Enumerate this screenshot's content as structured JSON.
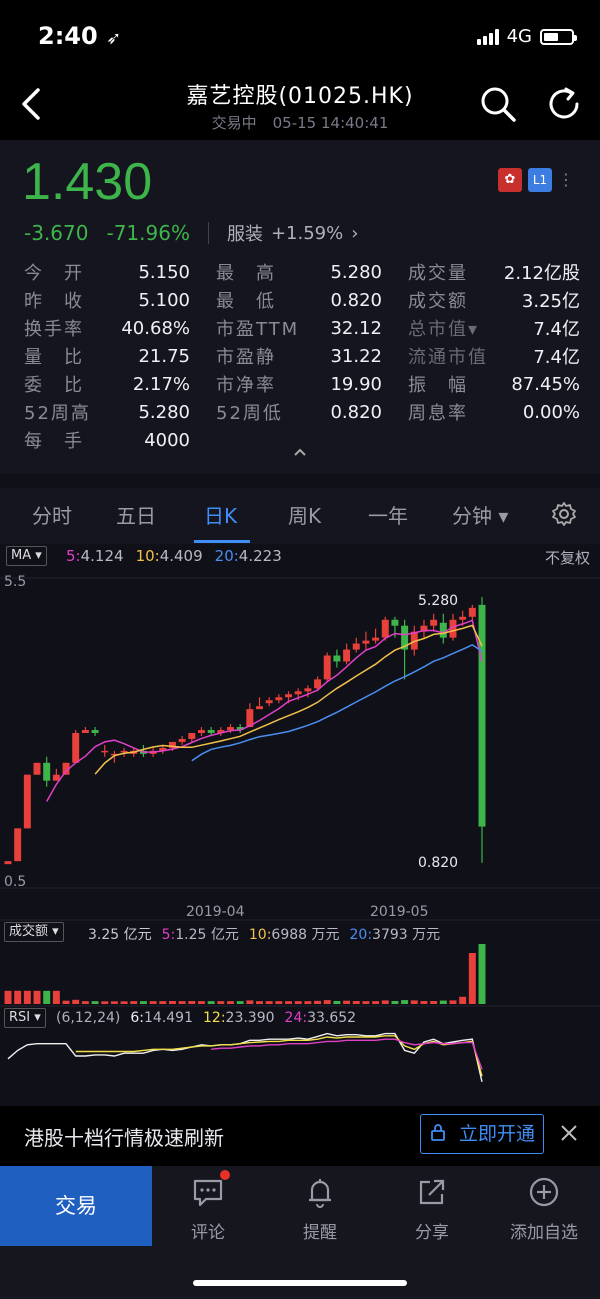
{
  "status": {
    "time": "2:40",
    "network": "4G"
  },
  "header": {
    "title": "嘉艺控股(01025.HK)",
    "status": "交易中",
    "datetime": "05-15 14:40:41"
  },
  "quote": {
    "price": "1.430",
    "change": "-3.670",
    "change_pct": "-71.96%",
    "sector": "服装",
    "sector_change": "+1.59%",
    "badge_market": "HK",
    "badge_level": "L1",
    "colors": {
      "down": "#3db54a",
      "up": "#e8403a",
      "accent": "#3f8ef5"
    }
  },
  "stats": [
    [
      {
        "k": "今　开",
        "v": "5.150"
      },
      {
        "k": "最　高",
        "v": "5.280"
      },
      {
        "k": "成交量",
        "v": "2.12亿股"
      }
    ],
    [
      {
        "k": "昨　收",
        "v": "5.100"
      },
      {
        "k": "最　低",
        "v": "0.820"
      },
      {
        "k": "成交额",
        "v": "3.25亿"
      }
    ],
    [
      {
        "k": "换手率",
        "v": "40.68%"
      },
      {
        "k": "市盈TTM",
        "v": "32.12"
      },
      {
        "k": "总市值▾",
        "v": "7.4亿"
      }
    ],
    [
      {
        "k": "量　比",
        "v": "21.75"
      },
      {
        "k": "市盈静",
        "v": "31.22"
      },
      {
        "k": "流通市值",
        "v": "7.4亿"
      }
    ],
    [
      {
        "k": "委　比",
        "v": "2.17%"
      },
      {
        "k": "市净率",
        "v": "19.90"
      },
      {
        "k": "振　幅",
        "v": "87.45%"
      }
    ],
    [
      {
        "k": "52周高",
        "v": "5.280"
      },
      {
        "k": "52周低",
        "v": "0.820"
      },
      {
        "k": "周息率",
        "v": "0.00%"
      }
    ],
    [
      {
        "k": "每　手",
        "v": "4000"
      }
    ]
  ],
  "tabs": [
    "分时",
    "五日",
    "日K",
    "周K",
    "一年",
    "分钟 ▾"
  ],
  "active_tab": "日K",
  "chart": {
    "indicator": "MA",
    "ma": [
      {
        "label": "5:",
        "value": "4.124",
        "color": "#e040c8"
      },
      {
        "label": "10:",
        "value": "4.409",
        "color": "#f2c04a"
      },
      {
        "label": "20:",
        "value": "4.223",
        "color": "#4a8ef0"
      }
    ],
    "adjust": "不复权",
    "y_top": "5.5",
    "y_bottom": "0.5",
    "high_label": "5.280",
    "low_label": "0.820",
    "dates": [
      "2019-04",
      "2019-05"
    ],
    "volume_indicator": "成交额",
    "volume": [
      {
        "label": "",
        "value": "3.25 亿元",
        "color": "#c8c8d0"
      },
      {
        "label": "5:",
        "value": "1.25 亿元",
        "color": "#e040c8"
      },
      {
        "label": "10:",
        "value": "6988 万元",
        "color": "#f2c04a"
      },
      {
        "label": "20:",
        "value": "3793 万元",
        "color": "#4a8ef0"
      }
    ],
    "rsi_indicator": "RSI",
    "rsi_params": "(6,12,24)",
    "rsi": [
      {
        "label": "6:",
        "value": "14.491",
        "color": "#f0f0f0"
      },
      {
        "label": "12:",
        "value": "23.390",
        "color": "#f2e04a"
      },
      {
        "label": "24:",
        "value": "33.652",
        "color": "#e040c8"
      }
    ]
  },
  "chart_data": {
    "type": "candlestick",
    "y_range": [
      0.5,
      5.5
    ],
    "x_ticks": [
      "2019-04",
      "2019-05"
    ],
    "candles": [
      [
        0.8,
        0.85,
        0.8,
        0.85
      ],
      [
        0.85,
        1.4,
        0.85,
        1.4
      ],
      [
        1.4,
        2.3,
        1.4,
        2.3
      ],
      [
        2.3,
        2.5,
        2.3,
        2.5
      ],
      [
        2.5,
        2.2,
        2.1,
        2.6
      ],
      [
        2.2,
        2.3,
        2.2,
        2.4
      ],
      [
        2.3,
        2.5,
        2.3,
        2.5
      ],
      [
        2.5,
        3.0,
        2.5,
        3.05
      ],
      [
        3.0,
        3.05,
        3.0,
        3.1
      ],
      [
        3.05,
        3.0,
        2.95,
        3.1
      ],
      [
        2.7,
        2.7,
        2.6,
        2.8
      ],
      [
        2.65,
        2.65,
        2.5,
        2.7
      ],
      [
        2.7,
        2.7,
        2.6,
        2.75
      ],
      [
        2.65,
        2.7,
        2.6,
        2.75
      ],
      [
        2.7,
        2.65,
        2.6,
        2.8
      ],
      [
        2.65,
        2.7,
        2.6,
        2.75
      ],
      [
        2.7,
        2.75,
        2.65,
        2.8
      ],
      [
        2.75,
        2.85,
        2.7,
        2.85
      ],
      [
        2.85,
        2.9,
        2.8,
        2.95
      ],
      [
        2.9,
        3.0,
        2.85,
        3.0
      ],
      [
        3.0,
        3.05,
        2.95,
        3.1
      ],
      [
        3.05,
        3.0,
        2.95,
        3.1
      ],
      [
        3.0,
        3.05,
        2.95,
        3.1
      ],
      [
        3.05,
        3.1,
        3.0,
        3.15
      ],
      [
        3.1,
        3.05,
        3.0,
        3.15
      ],
      [
        3.1,
        3.4,
        3.1,
        3.5
      ],
      [
        3.4,
        3.45,
        3.4,
        3.6
      ],
      [
        3.5,
        3.55,
        3.45,
        3.6
      ],
      [
        3.55,
        3.6,
        3.5,
        3.65
      ],
      [
        3.6,
        3.65,
        3.5,
        3.7
      ],
      [
        3.65,
        3.7,
        3.55,
        3.75
      ],
      [
        3.7,
        3.75,
        3.6,
        3.8
      ],
      [
        3.75,
        3.9,
        3.7,
        3.95
      ],
      [
        3.9,
        4.3,
        3.85,
        4.35
      ],
      [
        4.3,
        4.2,
        4.1,
        4.4
      ],
      [
        4.2,
        4.4,
        4.15,
        4.5
      ],
      [
        4.4,
        4.5,
        4.35,
        4.6
      ],
      [
        4.5,
        4.55,
        4.4,
        4.7
      ],
      [
        4.55,
        4.6,
        4.5,
        4.75
      ],
      [
        4.6,
        4.9,
        4.55,
        4.95
      ],
      [
        4.9,
        4.8,
        4.6,
        4.95
      ],
      [
        4.8,
        4.4,
        3.9,
        4.9
      ],
      [
        4.4,
        4.7,
        4.3,
        4.8
      ],
      [
        4.7,
        4.8,
        4.6,
        4.9
      ],
      [
        4.8,
        4.9,
        4.7,
        5.0
      ],
      [
        4.85,
        4.6,
        4.5,
        5.0
      ],
      [
        4.6,
        4.9,
        4.55,
        5.0
      ],
      [
        4.9,
        4.95,
        4.8,
        5.05
      ],
      [
        4.95,
        5.1,
        4.9,
        5.15
      ],
      [
        5.15,
        1.43,
        0.82,
        5.28
      ]
    ]
  },
  "promo": {
    "text": "港股十档行情极速刷新",
    "cta": "立即开通"
  },
  "bottom_nav": {
    "trade": "交易",
    "items": [
      "评论",
      "提醒",
      "分享",
      "添加自选"
    ]
  }
}
